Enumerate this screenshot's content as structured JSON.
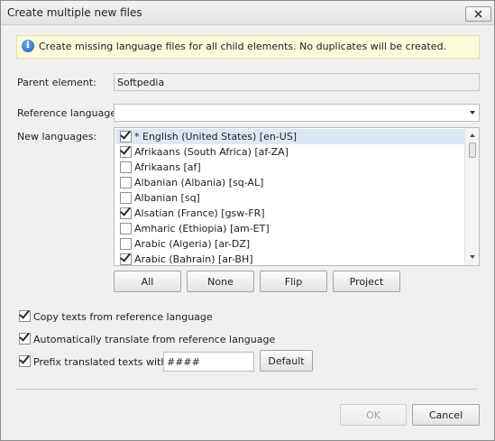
{
  "window": {
    "title": "Create multiple new files"
  },
  "info": {
    "text": "Create missing language files for all child elements. No duplicates will be created."
  },
  "form": {
    "parent_label": "Parent element:",
    "parent_value": "Softpedia",
    "reference_label": "Reference language:",
    "reference_value": "",
    "new_languages_label": "New languages:"
  },
  "languages": [
    {
      "label": "* English (United States) [en-US]",
      "checked": true,
      "selected": true
    },
    {
      "label": "Afrikaans (South Africa) [af-ZA]",
      "checked": true,
      "selected": false
    },
    {
      "label": "Afrikaans [af]",
      "checked": false,
      "selected": false
    },
    {
      "label": "Albanian (Albania) [sq-AL]",
      "checked": false,
      "selected": false
    },
    {
      "label": "Albanian [sq]",
      "checked": false,
      "selected": false
    },
    {
      "label": "Alsatian (France) [gsw-FR]",
      "checked": true,
      "selected": false
    },
    {
      "label": "Amharic (Ethiopia) [am-ET]",
      "checked": false,
      "selected": false
    },
    {
      "label": "Arabic (Algeria) [ar-DZ]",
      "checked": false,
      "selected": false
    },
    {
      "label": "Arabic (Bahrain) [ar-BH]",
      "checked": true,
      "selected": false
    }
  ],
  "list_buttons": {
    "all": "All",
    "none": "None",
    "flip": "Flip",
    "project": "Project"
  },
  "options": {
    "copy_texts": {
      "label": "Copy texts from reference language",
      "checked": true
    },
    "auto_translate": {
      "label": "Automatically translate from reference language",
      "checked": true
    },
    "prefix": {
      "label": "Prefix translated texts with:",
      "checked": true,
      "value": "####",
      "default_button": "Default"
    }
  },
  "footer": {
    "ok": "OK",
    "cancel": "Cancel"
  },
  "icons": {
    "info": "info-icon",
    "close": "close-icon",
    "dropdown": "chevron-down-icon"
  }
}
